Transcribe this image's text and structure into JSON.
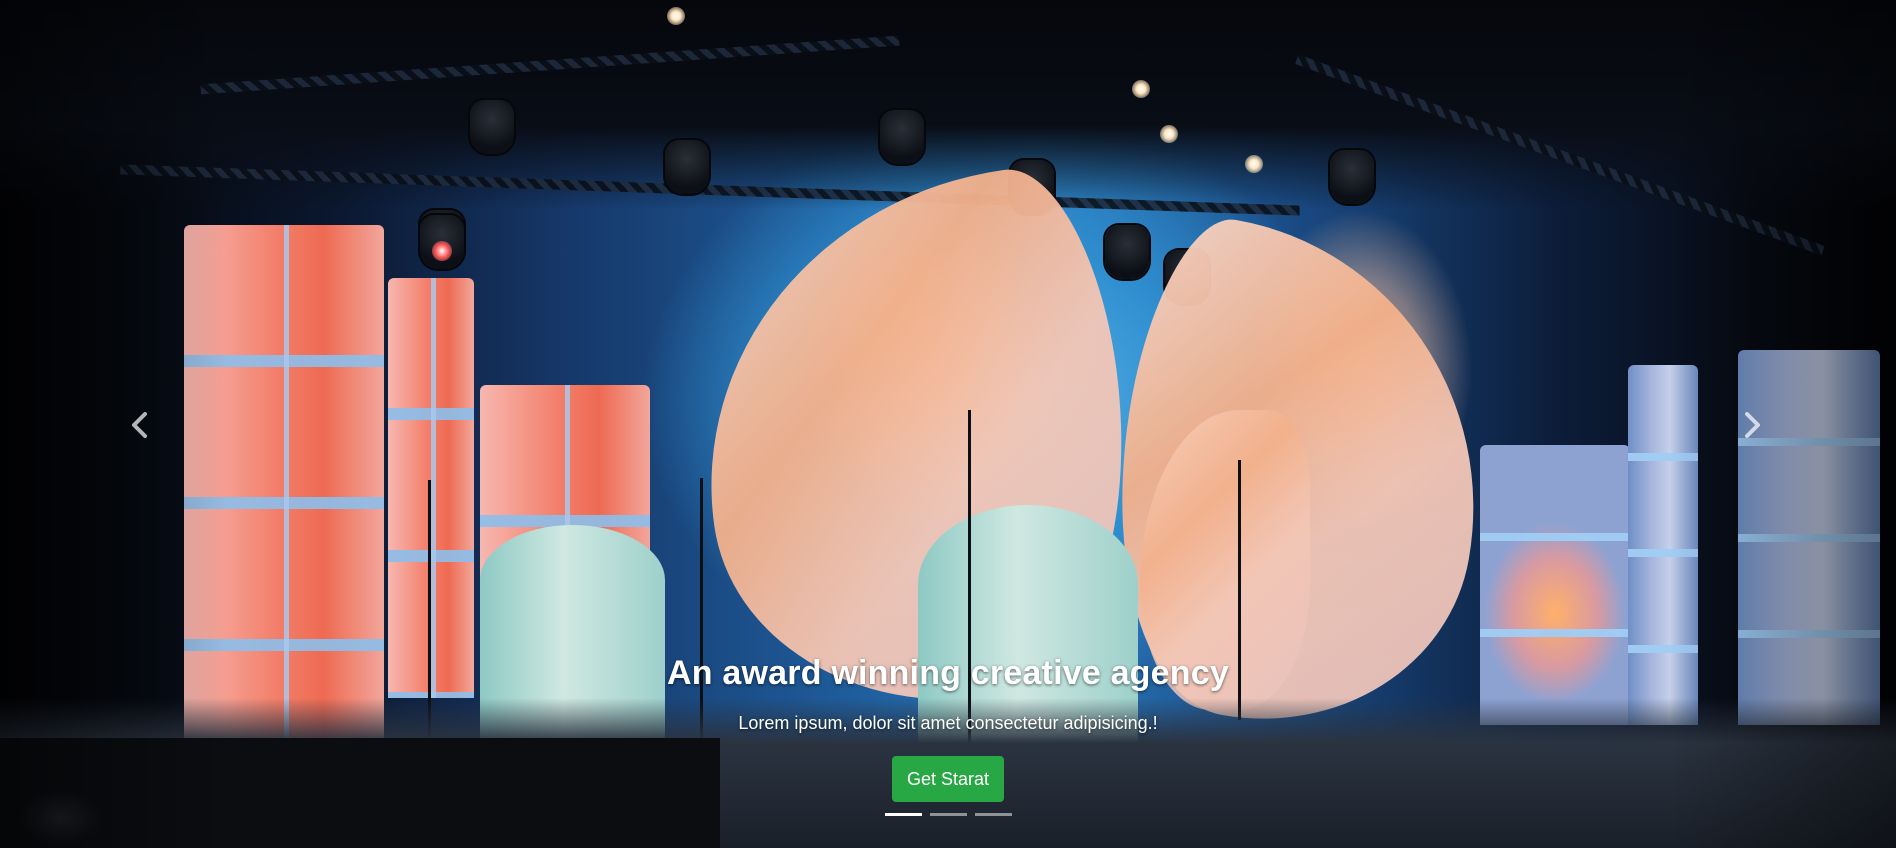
{
  "hero": {
    "title": "An award winning creative agency",
    "subtitle": "Lorem ipsum, dolor sit amet consectetur adipisicing.!",
    "cta_label": "Get Starat",
    "cta_color": "#28a745"
  },
  "carousel": {
    "prev_icon": "chevron-left-icon",
    "next_icon": "chevron-right-icon",
    "slide_count": 3,
    "active_slide": 1
  }
}
